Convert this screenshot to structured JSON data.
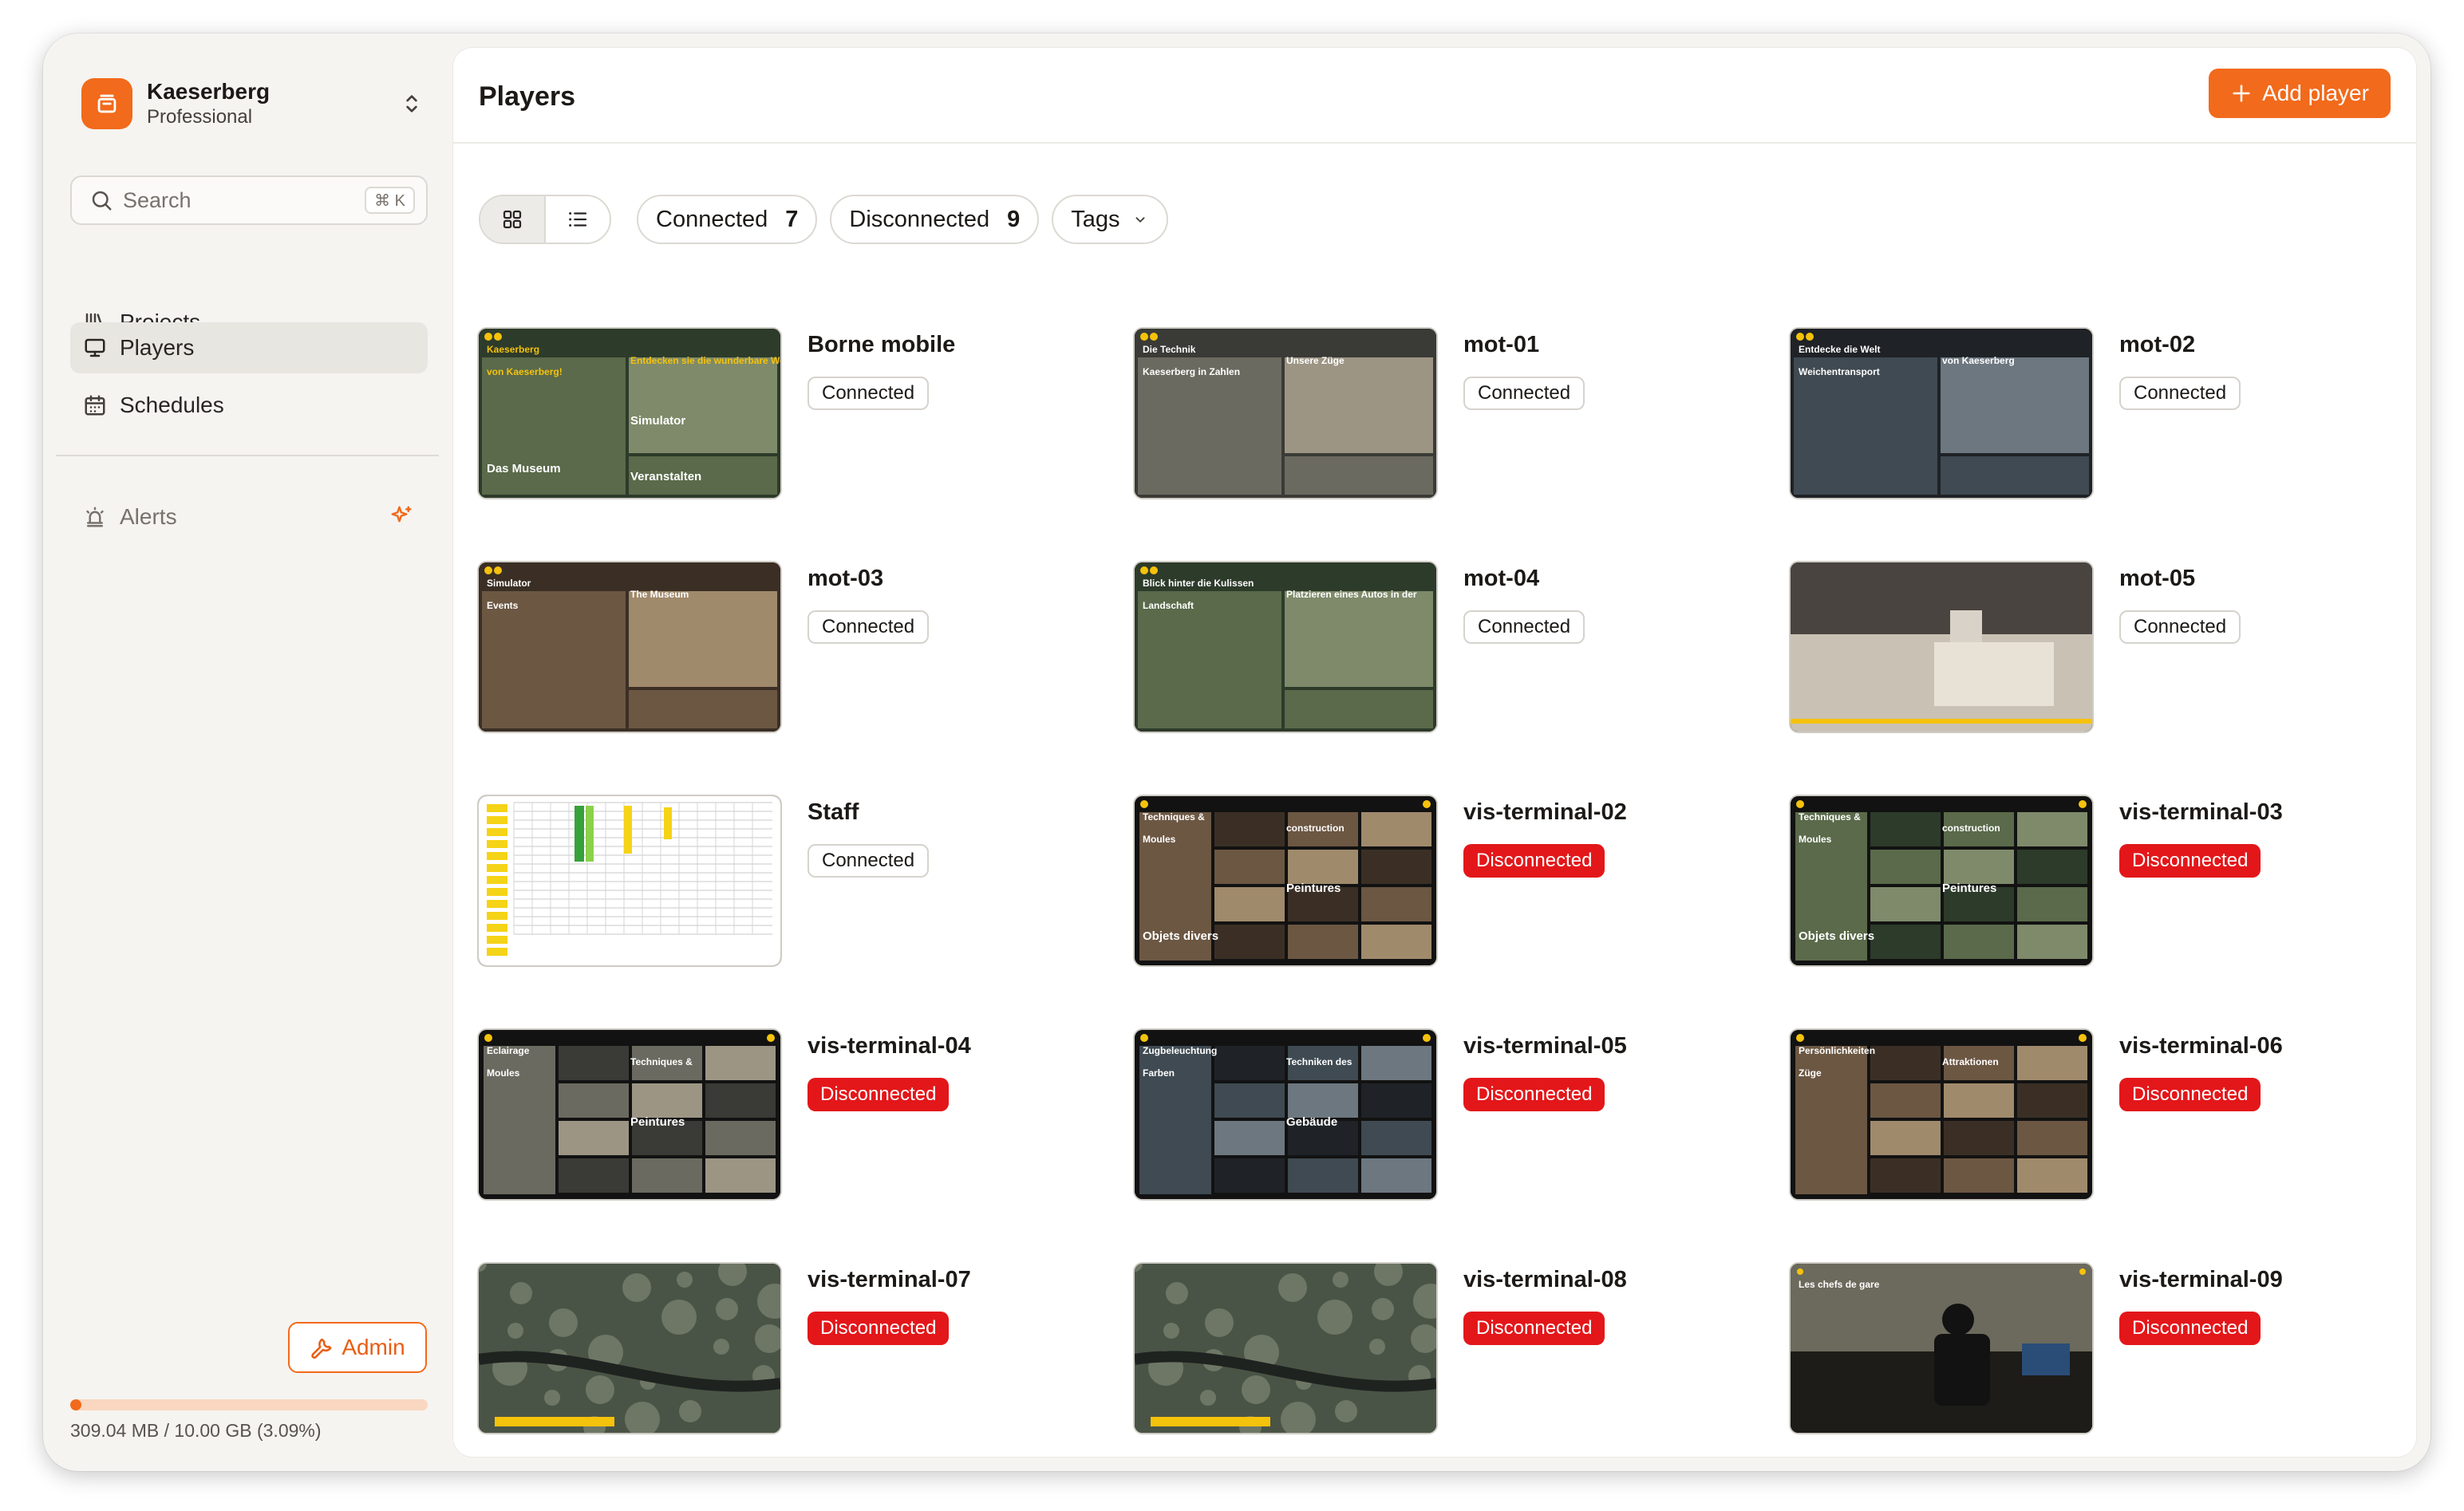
{
  "org": {
    "name": "Kaeserberg",
    "plan": "Professional"
  },
  "search": {
    "placeholder": "Search",
    "shortcut": "⌘ K"
  },
  "nav": {
    "projects": "Projects",
    "players": "Players",
    "schedules": "Schedules",
    "alerts": "Alerts"
  },
  "admin_label": "Admin",
  "storage": {
    "text": "309.04 MB / 10.00 GB (3.09%)",
    "fraction": 0.0309
  },
  "page": {
    "title": "Players",
    "add_button": "Add player"
  },
  "filters": {
    "connected": {
      "label": "Connected",
      "count": "7"
    },
    "disconnected": {
      "label": "Disconnected",
      "count": "9"
    },
    "tags": "Tags"
  },
  "colors": {
    "accent": "#f26a1b",
    "disconnected": "#e3171a"
  },
  "players": [
    {
      "name": "Borne mobile",
      "status": "Connected",
      "thumb_text": [
        "Kaeserberg",
        "Entdecken sie die wunderbare Welt",
        "von Kaeserberg!",
        "Simulator",
        "Das Museum",
        "Veranstalten"
      ]
    },
    {
      "name": "mot-01",
      "status": "Connected",
      "thumb_text": [
        "Die Technik",
        "Unsere Züge",
        "Kaeserberg in Zahlen"
      ]
    },
    {
      "name": "mot-02",
      "status": "Connected",
      "thumb_text": [
        "Entdecke die Welt",
        "von Kaeserberg",
        "Weichentransport"
      ]
    },
    {
      "name": "mot-03",
      "status": "Connected",
      "thumb_text": [
        "Simulator",
        "The Museum",
        "Events"
      ]
    },
    {
      "name": "mot-04",
      "status": "Connected",
      "thumb_text": [
        "Blick hinter die Kulissen",
        "Platzieren eines Autos in der",
        "Landschaft"
      ]
    },
    {
      "name": "mot-05",
      "status": "Connected",
      "thumb_text": []
    },
    {
      "name": "Staff",
      "status": "Connected",
      "thumb_text": []
    },
    {
      "name": "vis-terminal-02",
      "status": "Disconnected",
      "thumb_text": [
        "Techniques &",
        "construction",
        "Moules",
        "Peintures",
        "Objets divers"
      ]
    },
    {
      "name": "vis-terminal-03",
      "status": "Disconnected",
      "thumb_text": [
        "Techniques &",
        "construction",
        "Moules",
        "Peintures",
        "Objets divers"
      ]
    },
    {
      "name": "vis-terminal-04",
      "status": "Disconnected",
      "thumb_text": [
        "Eclairage",
        "Techniques &",
        "Moules",
        "Peintures"
      ]
    },
    {
      "name": "vis-terminal-05",
      "status": "Disconnected",
      "thumb_text": [
        "Zugbeleuchtung",
        "Techniken des",
        "Farben",
        "Gebäude"
      ]
    },
    {
      "name": "vis-terminal-06",
      "status": "Disconnected",
      "thumb_text": [
        "Persönlichkeiten",
        "Attraktionen",
        "Züge"
      ]
    },
    {
      "name": "vis-terminal-07",
      "status": "Disconnected",
      "thumb_text": []
    },
    {
      "name": "vis-terminal-08",
      "status": "Disconnected",
      "thumb_text": []
    },
    {
      "name": "vis-terminal-09",
      "status": "Disconnected",
      "thumb_text": [
        "Les chefs de gare"
      ]
    }
  ]
}
